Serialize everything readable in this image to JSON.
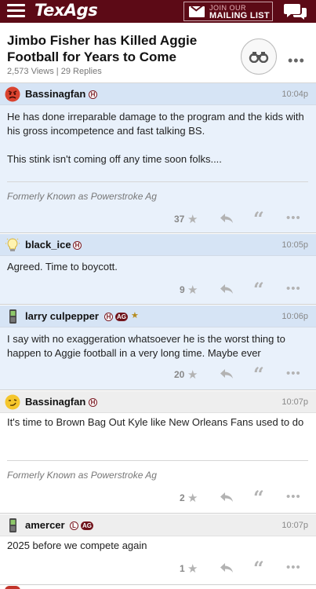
{
  "header": {
    "logo": "TexAgs",
    "mailing_line1": "JOIN OUR",
    "mailing_line2": "MAILING LIST",
    "menu_icon": "hamburger-menu-icon",
    "mail_icon": "envelope-icon",
    "chat_icon": "chat-bubbles-icon",
    "brand_color": "#5c0a16"
  },
  "thread": {
    "title": "Jimbo Fisher has Killed Aggie Football for Years to Come",
    "views": "2,573 Views",
    "separator": "|",
    "replies": "29 Replies",
    "watch_icon": "binoculars-icon",
    "more_icon": "more-options-icon"
  },
  "posts": [
    {
      "username": "Bassinagfan",
      "avatar_icon": "angry-face-icon",
      "badges": [
        "H"
      ],
      "time": "10:04p",
      "body": [
        "He has done irreparable damage to the program and the kids with his gross incompetence and fast talking BS.",
        "This stink isn't coming off any time soon folks...."
      ],
      "signature": "Formerly Known as Powerstroke Ag",
      "stars": "37"
    },
    {
      "username": "black_ice",
      "avatar_icon": "lightbulb-icon",
      "badges": [
        "H"
      ],
      "time": "10:05p",
      "body": [
        "Agreed. Time to boycott."
      ],
      "signature": "",
      "stars": "9"
    },
    {
      "username": "larry culpepper",
      "avatar_icon": "phone-icon",
      "badges": [
        "H",
        "AG",
        "★"
      ],
      "time": "10:06p",
      "body": [
        "I say with no exaggeration whatsoever he is the worst thing to happen to Aggie football in a very long time. Maybe ever"
      ],
      "signature": "",
      "stars": "20"
    },
    {
      "username": "Bassinagfan",
      "avatar_icon": "smirk-face-icon",
      "badges": [
        "H"
      ],
      "time": "10:07p",
      "body": [
        "It's time to Brown Bag Out Kyle like New Orleans Fans used to do"
      ],
      "signature": "Formerly Known as Powerstroke Ag",
      "stars": "2"
    },
    {
      "username": "amercer",
      "avatar_icon": "phone-icon",
      "badges": [
        "L",
        "AG"
      ],
      "time": "10:07p",
      "body": [
        "2025 before we compete again"
      ],
      "signature": "",
      "stars": "1"
    }
  ],
  "action_icons": {
    "star": "star-icon",
    "reply": "reply-arrow-icon",
    "quote": "quote-icon",
    "more": "more-options-icon"
  }
}
